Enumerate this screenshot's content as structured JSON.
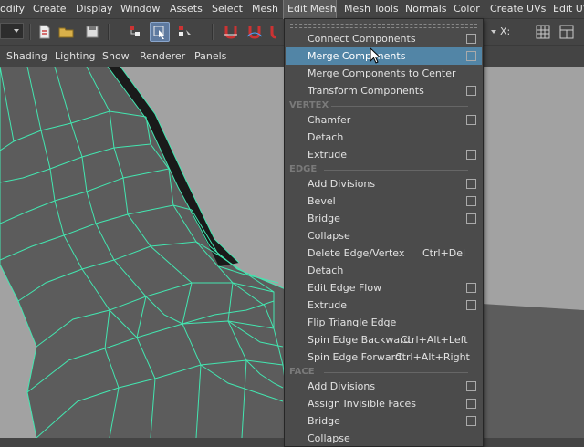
{
  "menubar": {
    "items": [
      "odify",
      "Create",
      "Display",
      "Window",
      "Assets",
      "Select",
      "Mesh",
      "Edit Mesh",
      "Mesh Tools",
      "Normals",
      "Color",
      "Create UVs",
      "Edit UV"
    ]
  },
  "toolbar": {
    "right_label": "X:"
  },
  "panel": {
    "items": [
      "Shading",
      "Lighting",
      "Show",
      "Renderer",
      "Panels"
    ]
  },
  "menu": {
    "connect_components": "Connect Components",
    "merge_components": "Merge Components",
    "merge_to_center": "Merge Components to Center",
    "transform_components": "Transform Components",
    "section_vertex": "VERTEX",
    "chamfer": "Chamfer",
    "detach_vertex": "Detach",
    "extrude_vertex": "Extrude",
    "section_edge": "EDGE",
    "add_divisions_edge": "Add Divisions",
    "bevel": "Bevel",
    "bridge_edge": "Bridge",
    "collapse_edge": "Collapse",
    "delete_edge_vertex": "Delete Edge/Vertex",
    "delete_edge_vertex_shortcut": "Ctrl+Del",
    "detach_edge": "Detach",
    "edit_edge_flow": "Edit Edge Flow",
    "extrude_edge": "Extrude",
    "flip_triangle_edge": "Flip Triangle Edge",
    "spin_edge_backward": "Spin Edge Backward",
    "spin_edge_backward_shortcut": "Ctrl+Alt+Left",
    "spin_edge_forward": "Spin Edge Forward",
    "spin_edge_forward_shortcut": "Ctrl+Alt+Right",
    "section_face": "FACE",
    "add_divisions_face": "Add Divisions",
    "assign_invisible_faces": "Assign Invisible Faces",
    "bridge_face": "Bridge",
    "collapse_face": "Collapse"
  },
  "colors": {
    "highlight": "#5285a6",
    "wireframe": "#43e6b0",
    "viewport_bg": "#a2a2a2",
    "mesh_face": "#5e5e5e"
  }
}
